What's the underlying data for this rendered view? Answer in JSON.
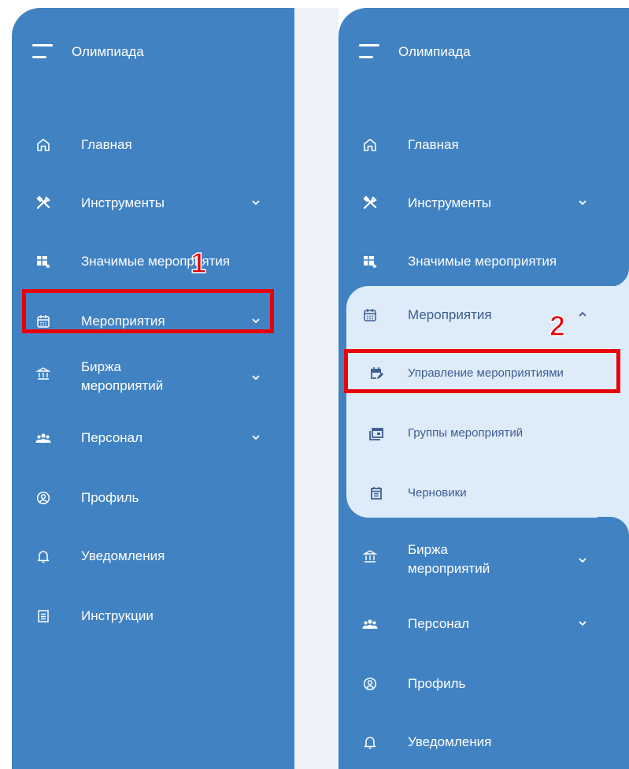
{
  "screens": [
    {
      "app_title": "Олимпиада",
      "nav": [
        {
          "label": "Главная",
          "icon": "home-icon"
        },
        {
          "label": "Инструменты",
          "icon": "tools-icon",
          "expandable": true
        },
        {
          "label": "Значимые мероприятия",
          "icon": "table-star-icon"
        },
        {
          "label": "Мероприятия",
          "icon": "calendar-icon",
          "expandable": true
        },
        {
          "label": "Биржа мероприятий",
          "icon": "bank-icon",
          "expandable": true
        },
        {
          "label": "Персонал",
          "icon": "people-icon",
          "expandable": true
        },
        {
          "label": "Профиль",
          "icon": "profile-icon"
        },
        {
          "label": "Уведомления",
          "icon": "bell-icon"
        },
        {
          "label": "Инструкции",
          "icon": "document-icon"
        }
      ]
    },
    {
      "app_title": "Олимпиада",
      "nav": [
        {
          "label": "Главная",
          "icon": "home-icon"
        },
        {
          "label": "Инструменты",
          "icon": "tools-icon",
          "expandable": true
        },
        {
          "label": "Значимые мероприятия",
          "icon": "table-star-icon"
        },
        {
          "label": "Мероприятия",
          "icon": "calendar-icon",
          "expandable": true,
          "expanded": true
        },
        {
          "label": "Биржа мероприятий",
          "icon": "bank-icon",
          "expandable": true
        },
        {
          "label": "Персонал",
          "icon": "people-icon",
          "expandable": true
        },
        {
          "label": "Профиль",
          "icon": "profile-icon"
        },
        {
          "label": "Уведомления",
          "icon": "bell-icon"
        }
      ],
      "submenu": [
        {
          "label": "Управление мероприятиями",
          "icon": "calendar-edit-icon"
        },
        {
          "label": "Группы мероприятий",
          "icon": "calendar-group-icon"
        },
        {
          "label": "Черновики",
          "icon": "drafts-icon"
        }
      ]
    }
  ],
  "annotations": [
    "1",
    "2"
  ],
  "colors": {
    "sidebar_bg": "#4182c3",
    "submenu_bg": "#deebf8",
    "submenu_text": "#3d5d93",
    "highlight": "#e8000b"
  }
}
